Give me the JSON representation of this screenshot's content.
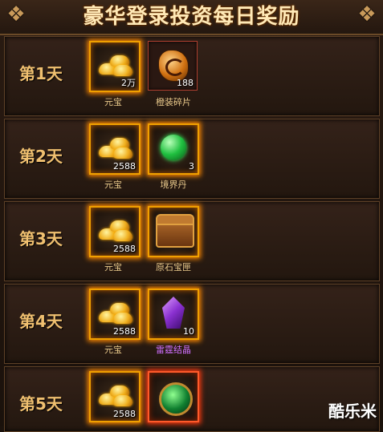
{
  "header": {
    "title": "豪华登录投资每日奖励"
  },
  "days": [
    {
      "day": "第1天",
      "item1": {
        "count": "2万",
        "label": "元宝"
      },
      "item2": {
        "count": "188",
        "label": "橙装碎片"
      }
    },
    {
      "day": "第2天",
      "item1": {
        "count": "2588",
        "label": "元宝"
      },
      "item2": {
        "count": "3",
        "label": "境界丹"
      }
    },
    {
      "day": "第3天",
      "item1": {
        "count": "2588",
        "label": "元宝"
      },
      "item2": {
        "count": "",
        "label": "原石宝匣"
      }
    },
    {
      "day": "第4天",
      "item1": {
        "count": "2588",
        "label": "元宝"
      },
      "item2": {
        "count": "10",
        "label": "雷霆结晶"
      }
    },
    {
      "day": "第5天",
      "item1": {
        "count": "2588",
        "label": ""
      },
      "item2": {
        "count": "",
        "label": ""
      }
    }
  ],
  "watermark": "酷乐米",
  "icons": [
    "gold-ingot-icon",
    "orange-fragment-icon",
    "green-pill-icon",
    "treasure-chest-icon",
    "purple-crystal-icon",
    "green-ornament-icon"
  ]
}
